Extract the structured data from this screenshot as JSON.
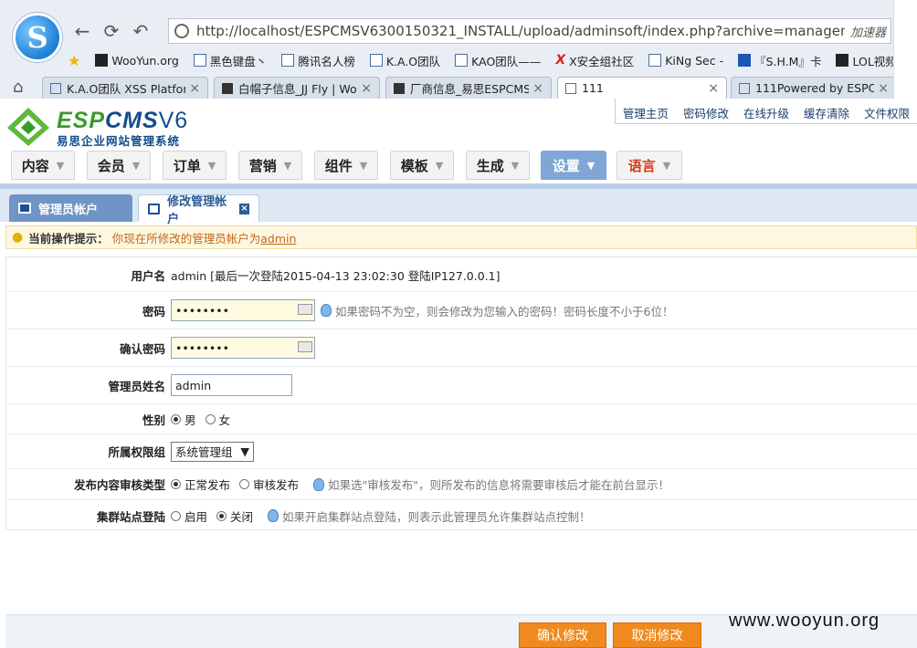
{
  "browser": {
    "logo_letter": "S",
    "url": "http://localhost/ESPCMSV6300150321_INSTALL/upload/adminsoft/index.php?archive=management&act",
    "accelerator": "加速器",
    "bookmarks": [
      "WooYun.org",
      "黑色键盘丶",
      "腾讯名人榜",
      "K.A.O团队",
      "KAO团队——",
      "X安全组社区",
      "KiNg Sec -",
      "『S.H.M』卡",
      "LOL视频_英"
    ],
    "tabs": [
      {
        "title": "K.A.O团队 XSS Platforn"
      },
      {
        "title": "白帽子信息_JJ Fly | Woo"
      },
      {
        "title": "厂商信息_易思ESPCMS企"
      },
      {
        "title": "111"
      },
      {
        "title": "111Powered by ESPCM"
      }
    ]
  },
  "header": {
    "logo_green": "ESP",
    "logo_blue": "CMS",
    "logo_version": "V6",
    "logo_sub": "易思企业网站管理系统",
    "links": [
      "管理主页",
      "密码修改",
      "在线升级",
      "缓存清除",
      "文件权限"
    ]
  },
  "menu": [
    "内容",
    "会员",
    "订单",
    "营销",
    "组件",
    "模板",
    "生成",
    "设置",
    "语言"
  ],
  "subtabs": {
    "list": "管理员帐户",
    "edit": "修改管理帐户"
  },
  "tip": {
    "label": "当前操作提示：",
    "text": "你现在所修改的管理员帐户为",
    "user": "admin"
  },
  "form": {
    "username_label": "用户名",
    "username_value": "admin [最后一次登陆2015-04-13 23:02:30 登陆IP127.0.0.1]",
    "password_label": "密码",
    "password_value": "••••••••",
    "password_hint": "如果密码不为空，则会修改为您输入的密码！密码长度不小于6位！",
    "confirm_label": "确认密码",
    "confirm_value": "••••••••",
    "name_label": "管理员姓名",
    "name_value": "admin",
    "gender_label": "性别",
    "gender_male": "男",
    "gender_female": "女",
    "group_label": "所属权限组",
    "group_value": "系统管理组",
    "review_label": "发布内容审核类型",
    "review_normal": "正常发布",
    "review_audit": "审核发布",
    "review_hint": "如果选\"审核发布\"，则所发布的信息将需要审核后才能在前台显示！",
    "cluster_label": "集群站点登陆",
    "cluster_on": "启用",
    "cluster_off": "关闭",
    "cluster_hint": "如果开启集群站点登陆，则表示此管理员允许集群站点控制！"
  },
  "buttons": {
    "confirm": "确认修改",
    "cancel": "取消修改"
  },
  "watermark": "www.wooyun.org"
}
